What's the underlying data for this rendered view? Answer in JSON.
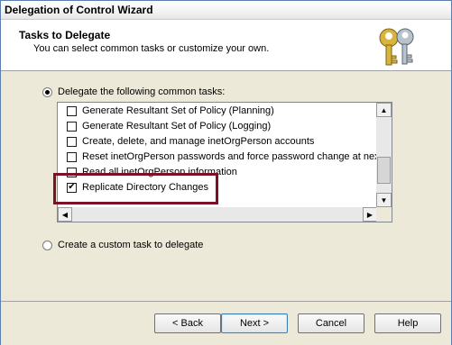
{
  "window": {
    "title": "Delegation of Control Wizard"
  },
  "header": {
    "title": "Tasks to Delegate",
    "subtitle": "You can select common tasks or customize your own.",
    "icon": "keys-icon"
  },
  "options": {
    "common": {
      "label": "Delegate the following common tasks:",
      "selected": true
    },
    "custom": {
      "label": "Create a custom task to delegate",
      "selected": false
    }
  },
  "tasks": [
    {
      "label": "Generate Resultant Set of Policy (Planning)",
      "checked": false
    },
    {
      "label": "Generate Resultant Set of Policy (Logging)",
      "checked": false
    },
    {
      "label": "Create, delete, and manage inetOrgPerson accounts",
      "checked": false
    },
    {
      "label": "Reset inetOrgPerson passwords and force password change at next l",
      "checked": false
    },
    {
      "label": "Read all inetOrgPerson information",
      "checked": false
    },
    {
      "label": "Replicate Directory Changes",
      "checked": true
    }
  ],
  "buttons": {
    "back": "< Back",
    "next": "Next >",
    "cancel": "Cancel",
    "help": "Help"
  },
  "colors": {
    "highlight": "#7a1126",
    "accent": "#3c7fb1"
  }
}
